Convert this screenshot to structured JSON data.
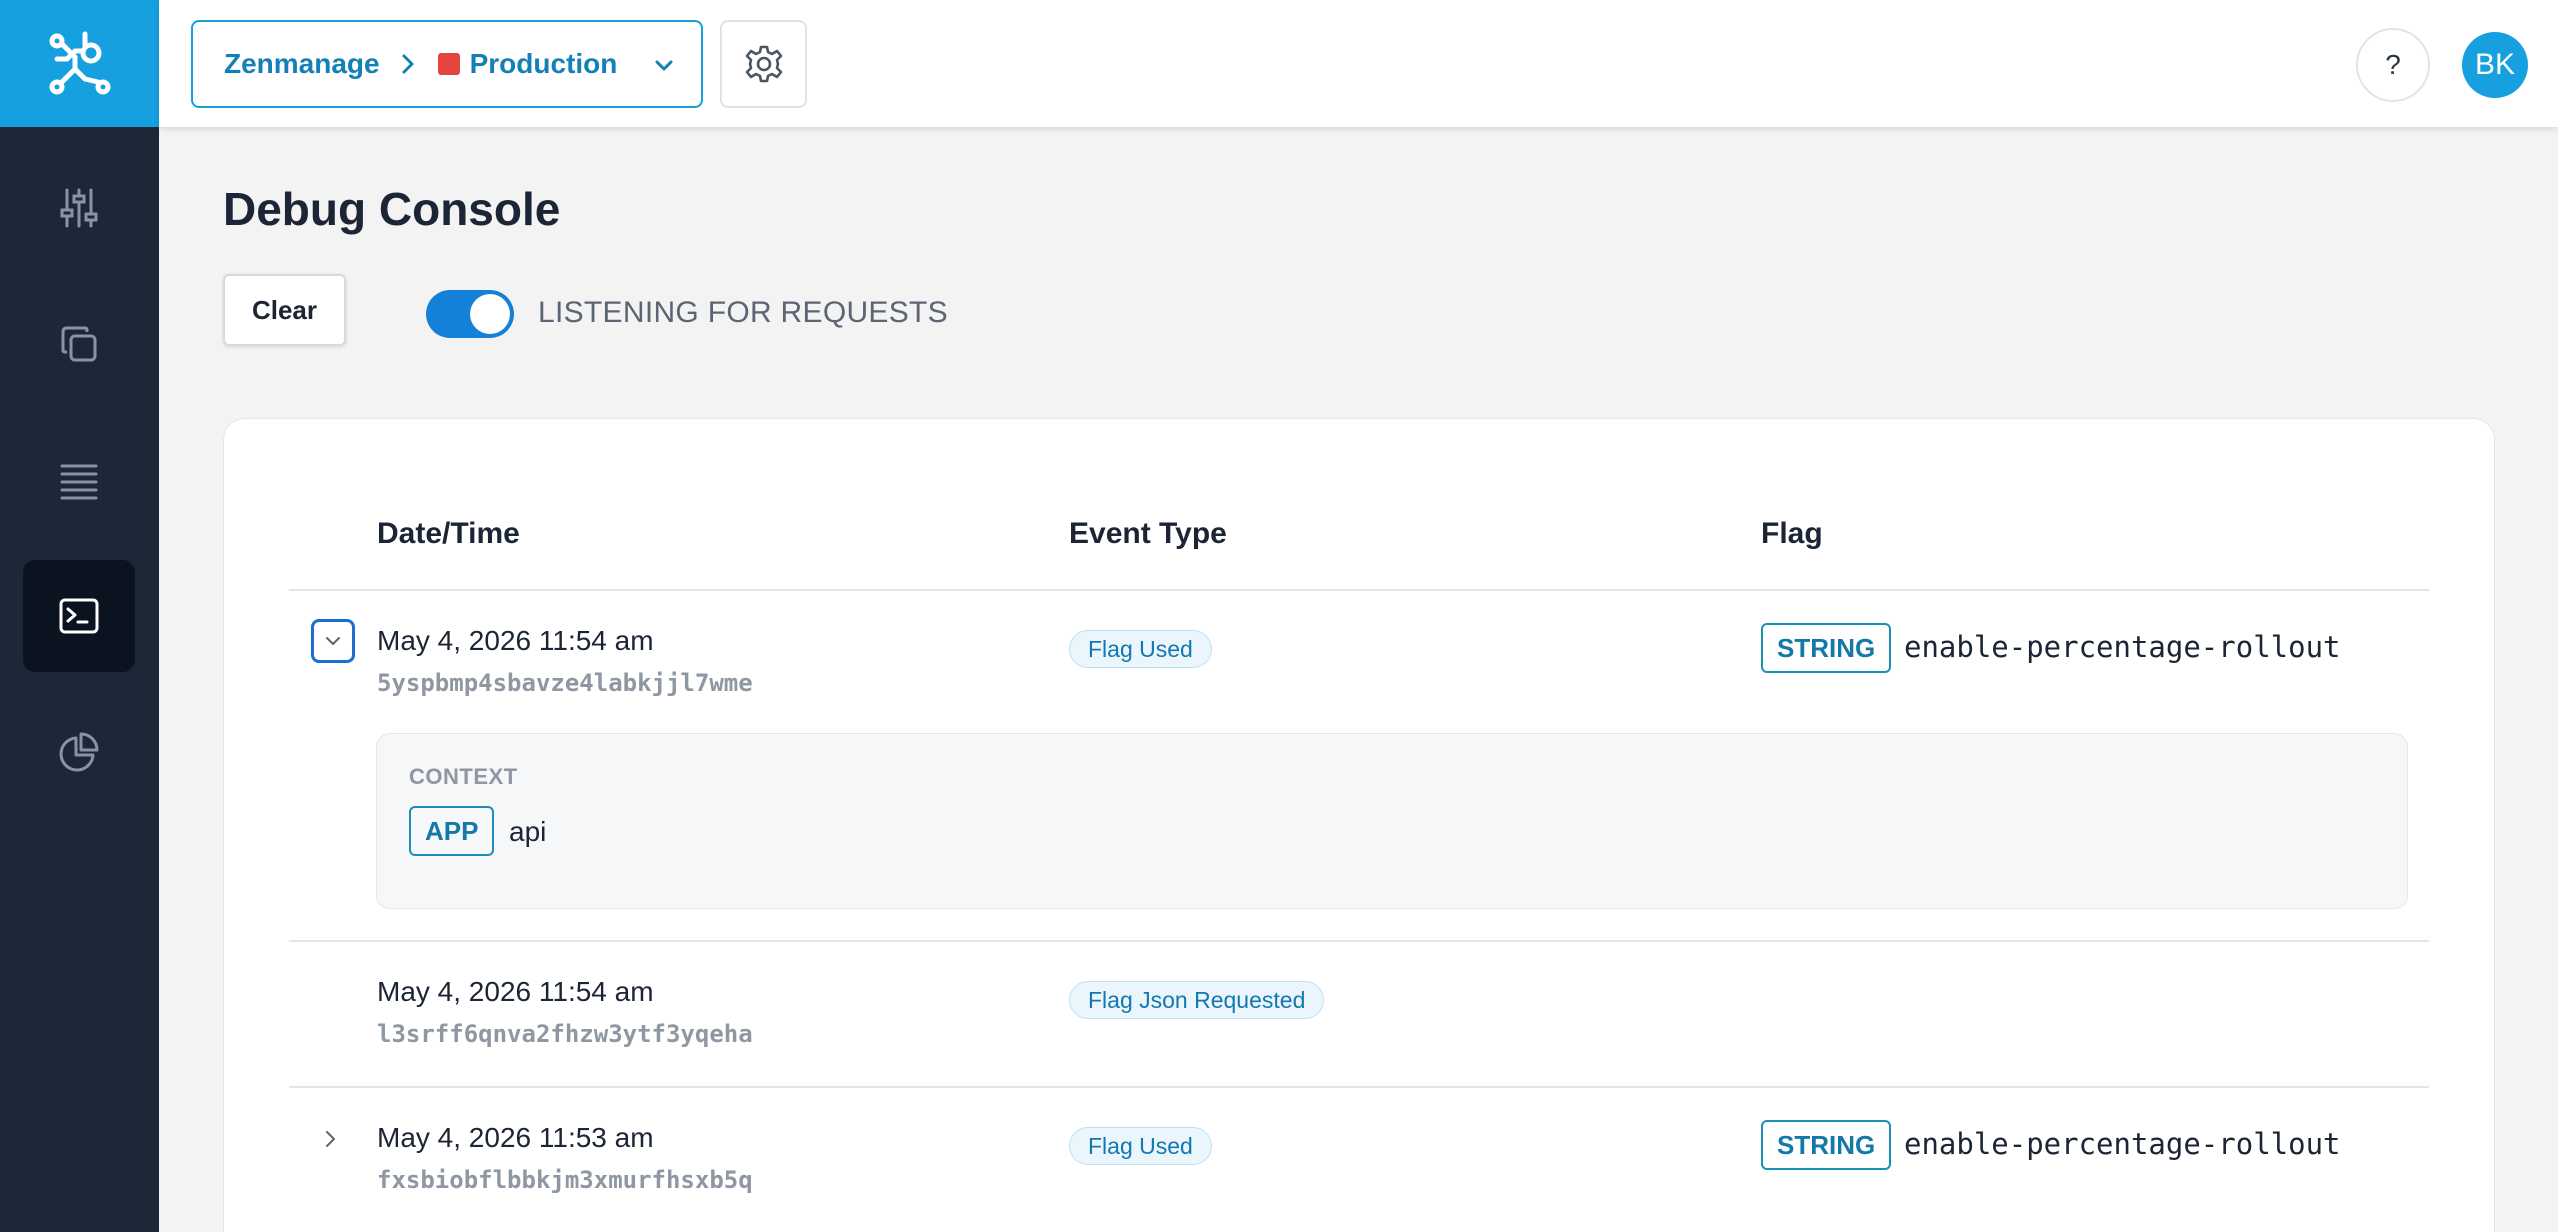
{
  "header": {
    "project": "Zenmanage",
    "environment": "Production",
    "environment_color": "#e5453d",
    "help_label": "?",
    "user_initials": "BK"
  },
  "sidebar": {
    "items": [
      {
        "icon": "sliders-icon",
        "active": false
      },
      {
        "icon": "copy-icon",
        "active": false
      },
      {
        "icon": "list-icon",
        "active": false
      },
      {
        "icon": "terminal-icon",
        "active": true
      },
      {
        "icon": "pie-chart-icon",
        "active": false
      }
    ]
  },
  "page": {
    "title": "Debug Console",
    "clear_label": "Clear",
    "listening_label": "LISTENING FOR REQUESTS",
    "listening_on": true
  },
  "table": {
    "columns": [
      "Date/Time",
      "Event Type",
      "Flag"
    ],
    "rows": [
      {
        "date": "May 4, 2026 11:54 am",
        "id": "5yspbmp4sbavze4labkjjl7wme",
        "event_type": "Flag Used",
        "flag_type": "STRING",
        "flag_key": "enable-percentage-rollout",
        "expanded": true,
        "context": {
          "label": "CONTEXT",
          "tag": "APP",
          "value": "api"
        }
      },
      {
        "date": "May 4, 2026 11:54 am",
        "id": "l3srff6qnva2fhzw3ytf3yqeha",
        "event_type": "Flag Json Requested"
      },
      {
        "date": "May 4, 2026 11:53 am",
        "id": "fxsbiobflbbkjm3xmurfhsxb5q",
        "event_type": "Flag Used",
        "flag_type": "STRING",
        "flag_key": "enable-percentage-rollout",
        "expanded": false
      }
    ]
  }
}
